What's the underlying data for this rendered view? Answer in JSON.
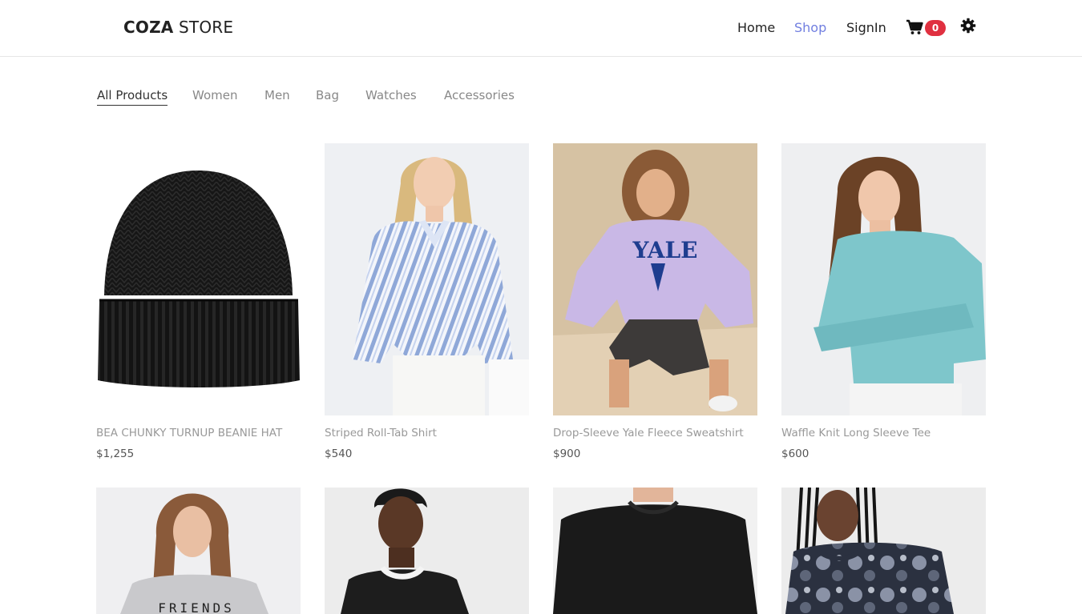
{
  "header": {
    "logo_bold": "COZA",
    "logo_light": " STORE",
    "nav": [
      {
        "label": "Home"
      },
      {
        "label": "Shop",
        "active": true
      },
      {
        "label": "SignIn"
      }
    ],
    "cart_count": "0",
    "cart_icon": "shopping-cart-icon",
    "settings_icon": "gear-icon",
    "accent_color": "#717fe0",
    "badge_color": "#e03040"
  },
  "filters": [
    {
      "label": "All Products",
      "active": true
    },
    {
      "label": "Women"
    },
    {
      "label": "Men"
    },
    {
      "label": "Bag"
    },
    {
      "label": "Watches"
    },
    {
      "label": "Accessories"
    }
  ],
  "products": [
    {
      "name": "BEA CHUNKY TURNUP BEANIE HAT",
      "price": "$1,255"
    },
    {
      "name": "Striped Roll-Tab Shirt",
      "price": "$540"
    },
    {
      "name": "Drop-Sleeve Yale Fleece Sweatshirt",
      "price": "$900"
    },
    {
      "name": "Waffle Knit Long Sleeve Tee",
      "price": "$600"
    },
    {
      "name": "",
      "price": ""
    },
    {
      "name": "",
      "price": ""
    },
    {
      "name": "",
      "price": ""
    },
    {
      "name": "",
      "price": ""
    }
  ],
  "image_texts": {
    "sweatshirt_print": "YALE",
    "friends_print": "FRIENDS"
  }
}
